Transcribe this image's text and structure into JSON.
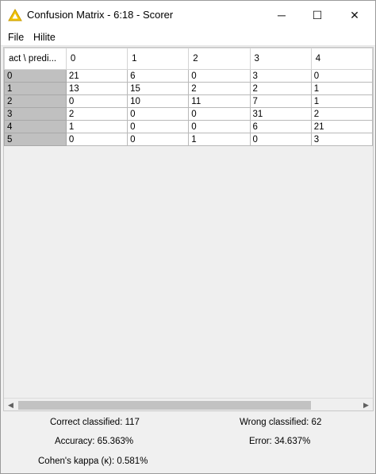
{
  "window": {
    "title": "Confusion Matrix - 6:18 - Scorer",
    "controls": {
      "minimize": "─",
      "maximize": "☐",
      "close": "✕"
    }
  },
  "menu": {
    "file": "File",
    "hilite": "Hilite"
  },
  "matrix": {
    "corner_header": "act \\ predi...",
    "column_headers": [
      "0",
      "1",
      "2",
      "3",
      "4"
    ],
    "rows": [
      {
        "label": "0",
        "cells": [
          "21",
          "6",
          "0",
          "3",
          "0"
        ]
      },
      {
        "label": "1",
        "cells": [
          "13",
          "15",
          "2",
          "2",
          "1"
        ]
      },
      {
        "label": "2",
        "cells": [
          "0",
          "10",
          "11",
          "7",
          "1"
        ]
      },
      {
        "label": "3",
        "cells": [
          "2",
          "0",
          "0",
          "31",
          "2"
        ]
      },
      {
        "label": "4",
        "cells": [
          "1",
          "0",
          "0",
          "6",
          "21"
        ]
      },
      {
        "label": "5",
        "cells": [
          "0",
          "0",
          "1",
          "0",
          "3"
        ]
      }
    ]
  },
  "scrollbar": {
    "left_arrow": "◀",
    "right_arrow": "▶"
  },
  "stats": {
    "correct": "Correct classified:  117",
    "wrong": "Wrong classified:  62",
    "accuracy": "Accuracy:  65.363%",
    "error": "Error:  34.637%",
    "kappa": "Cohen's kappa (κ):  0.581%"
  }
}
